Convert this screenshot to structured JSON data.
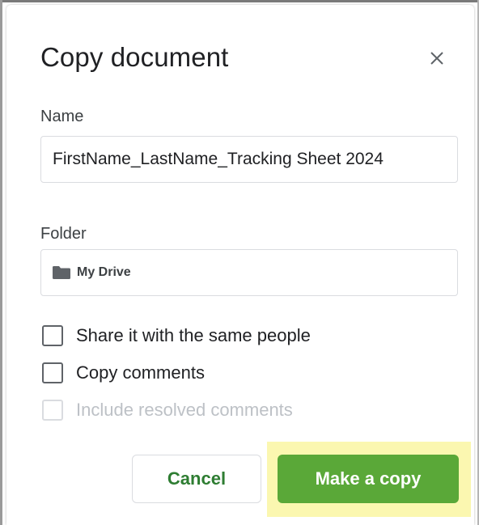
{
  "dialog": {
    "title": "Copy document",
    "close_icon": "close-icon"
  },
  "name_field": {
    "label": "Name",
    "value": "FirstName_LastName_Tracking Sheet 2024"
  },
  "folder_field": {
    "label": "Folder",
    "icon": "folder-icon",
    "value": "My Drive"
  },
  "options": [
    {
      "label": "Share it with the same people",
      "checked": false,
      "enabled": true
    },
    {
      "label": "Copy comments",
      "checked": false,
      "enabled": true
    },
    {
      "label": "Include resolved comments",
      "checked": false,
      "enabled": false
    }
  ],
  "buttons": {
    "cancel_label": "Cancel",
    "confirm_label": "Make a copy"
  },
  "colors": {
    "confirm_button": "#5aa838",
    "cancel_text": "#2e7d32",
    "highlight": "#fbf7b0"
  }
}
